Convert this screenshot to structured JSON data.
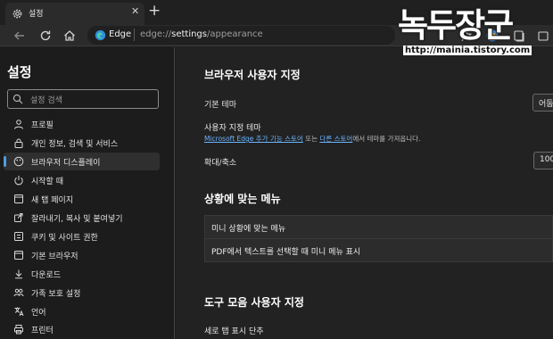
{
  "tab": {
    "title": "설정",
    "close": "✕",
    "new_tab": "+"
  },
  "toolbar": {
    "back": "back-arrow-icon",
    "refresh": "refresh-icon",
    "home": "home-icon"
  },
  "address": {
    "label": "Edge",
    "url_prefix": "edge://",
    "url_bold": "settings",
    "url_suffix": "/appearance"
  },
  "sidebar": {
    "title": "설정",
    "search_placeholder": "설정 검색",
    "items": [
      {
        "label": "프로필",
        "icon": "profile-icon"
      },
      {
        "label": "개인 정보, 검색 및 서비스",
        "icon": "lock-icon"
      },
      {
        "label": "브라우저 디스플레이",
        "icon": "appearance-icon",
        "active": true
      },
      {
        "label": "시작할 때",
        "icon": "power-icon"
      },
      {
        "label": "새 탭 페이지",
        "icon": "new-tab-icon"
      },
      {
        "label": "잘라내기, 복사 및 붙여넣기",
        "icon": "share-icon"
      },
      {
        "label": "쿠키 및 사이트 권한",
        "icon": "cookie-icon"
      },
      {
        "label": "기본 브라우저",
        "icon": "browser-icon"
      },
      {
        "label": "다운로드",
        "icon": "download-icon"
      },
      {
        "label": "가족 보호 설정",
        "icon": "family-icon"
      },
      {
        "label": "언어",
        "icon": "language-icon"
      },
      {
        "label": "프린터",
        "icon": "printer-icon"
      }
    ]
  },
  "main": {
    "section1_title": "브라우저 사용자 지정",
    "default_theme_label": "기본 테마",
    "default_theme_value": "어둡",
    "custom_theme_label": "사용자 지정 테마",
    "custom_theme_link1": "Microsoft Edge 추가 기능 스토어",
    "custom_theme_mid": " 또는 ",
    "custom_theme_link2": "다른 스토어",
    "custom_theme_tail": "에서 테마를 가져옵니다.",
    "zoom_label": "확대/축소",
    "zoom_value": "100",
    "section2_title": "상황에 맞는 메뉴",
    "menu_item1": "미니 상황에 맞는 메뉴",
    "menu_item2": "PDF에서 텍스트를 선택할 때 미니 메뉴 표시",
    "section3_title": "도구 모음 사용자 지정",
    "vertical_tabs_label": "세로 탭 표시 단추"
  },
  "watermark": {
    "big": "녹두장군",
    "url": "http://mainia.tistory.com"
  },
  "colors": {
    "accent": "#4a9de8",
    "link": "#69b4ff",
    "bg": "#222222",
    "sidebar_bg": "#1c1c1c"
  }
}
